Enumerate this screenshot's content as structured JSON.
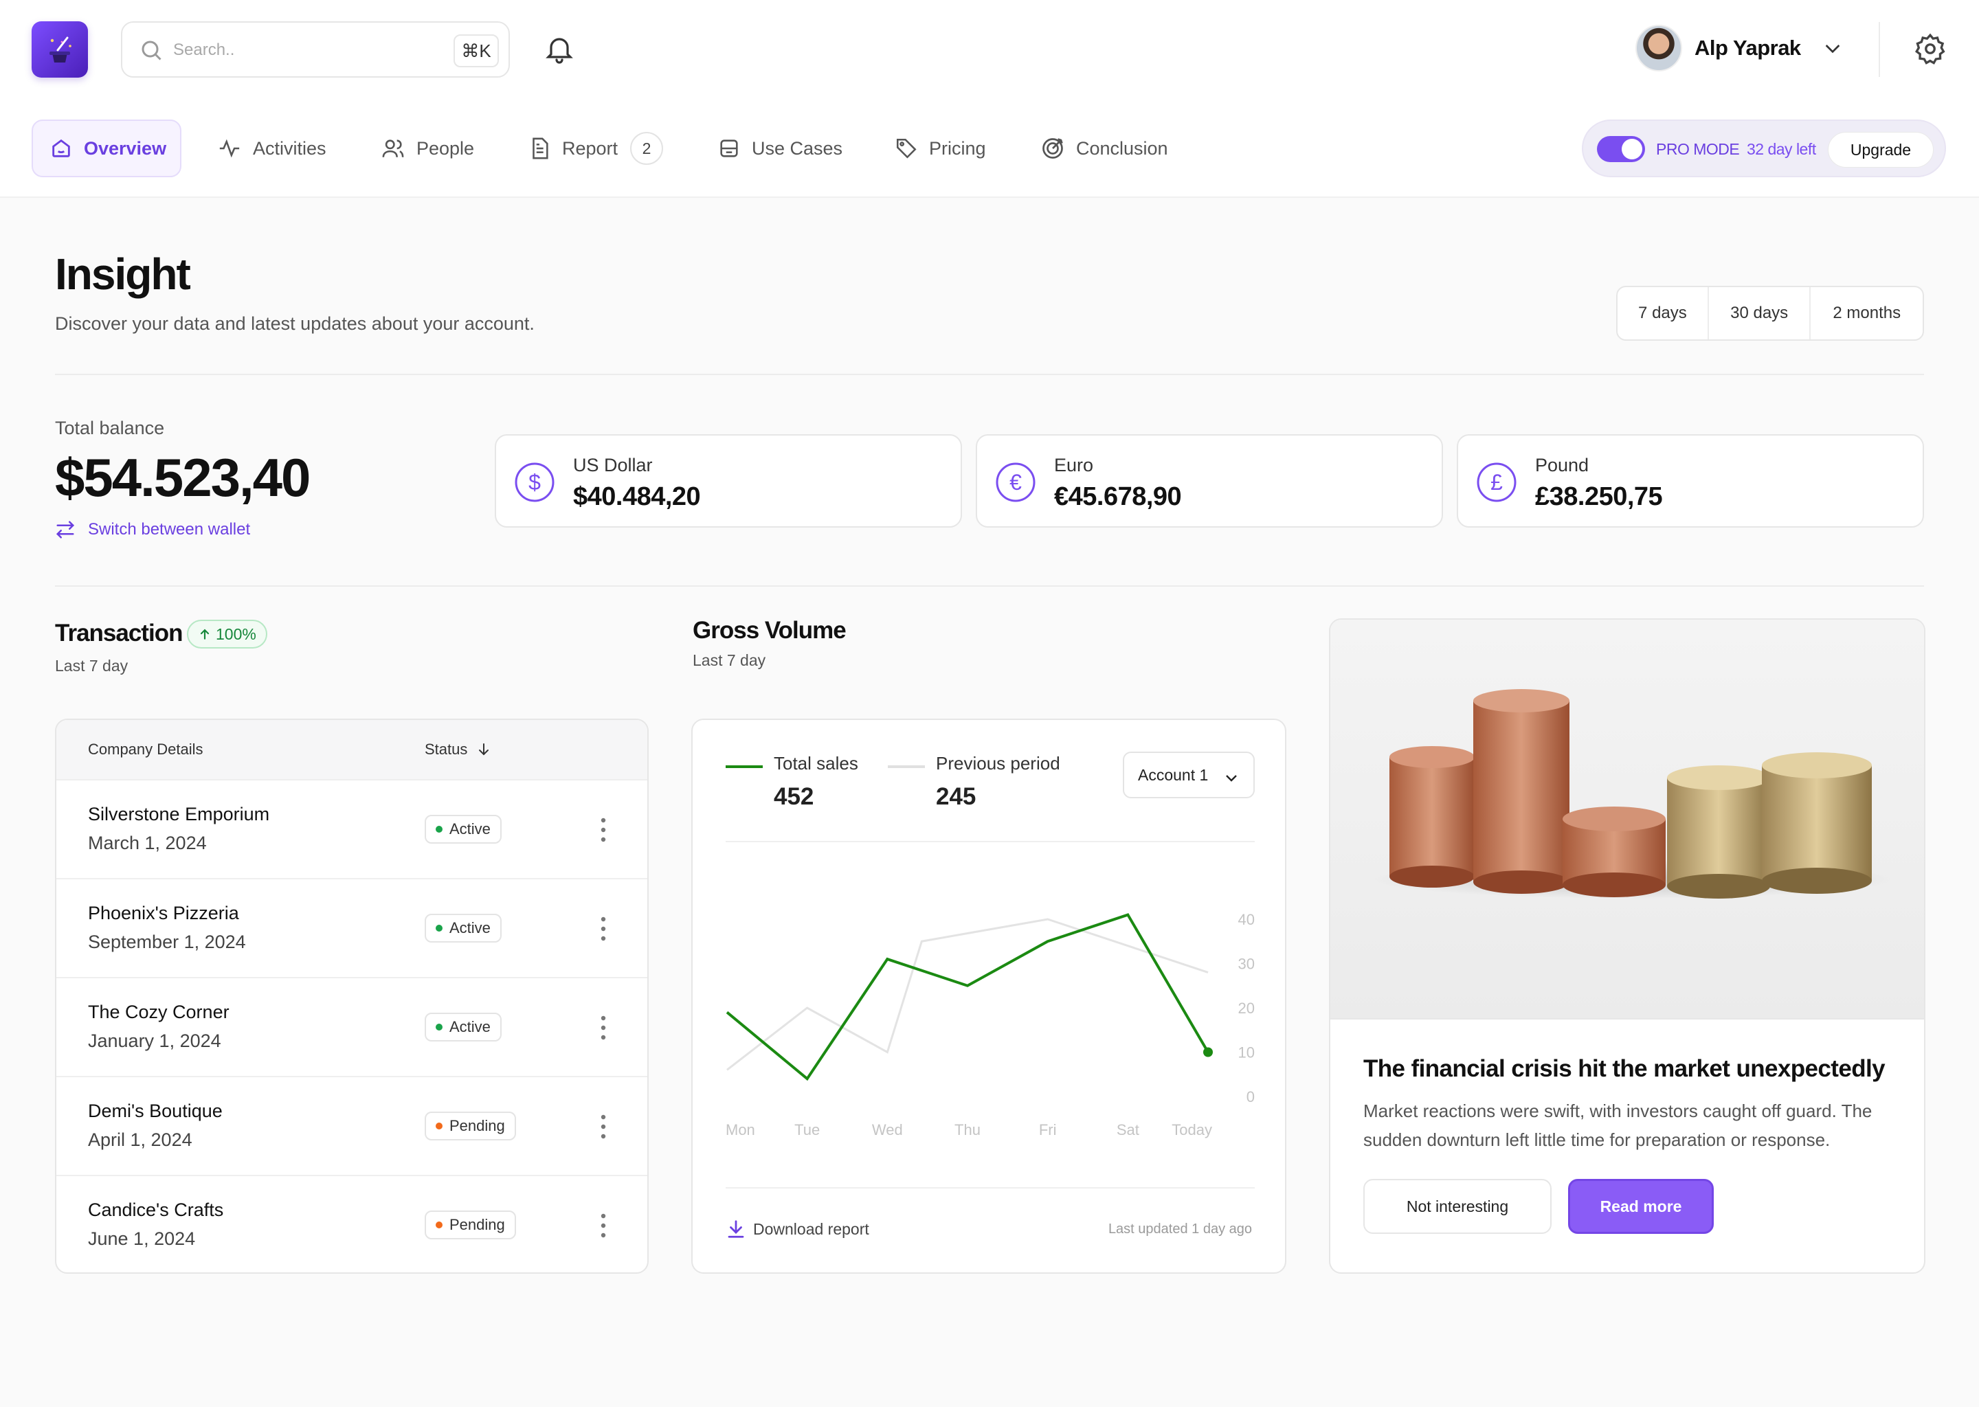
{
  "search": {
    "placeholder": "Search..",
    "shortcut": "⌘K"
  },
  "user": {
    "name": "Alp Yaprak"
  },
  "nav": {
    "items": [
      {
        "label": "Overview",
        "icon": "home-icon",
        "active": true
      },
      {
        "label": "Activities",
        "icon": "activity-icon"
      },
      {
        "label": "People",
        "icon": "people-icon"
      },
      {
        "label": "Report",
        "icon": "document-icon",
        "badge": "2"
      },
      {
        "label": "Use Cases",
        "icon": "database-icon"
      },
      {
        "label": "Pricing",
        "icon": "tag-icon"
      },
      {
        "label": "Conclusion",
        "icon": "target-icon"
      }
    ]
  },
  "promo": {
    "mode": "PRO MODE",
    "days_left": "32 day left",
    "upgrade": "Upgrade",
    "enabled": true
  },
  "page": {
    "title": "Insight",
    "subtitle": "Discover your data and latest updates about your account."
  },
  "range": {
    "options": [
      "7 days",
      "30 days",
      "2 months"
    ]
  },
  "balance": {
    "label": "Total balance",
    "amount": "$54.523,40",
    "switch_label": "Switch between wallet",
    "currencies": [
      {
        "name": "US Dollar",
        "value": "$40.484,20",
        "symbol": "$",
        "icon": "dollar-icon"
      },
      {
        "name": "Euro",
        "value": "€45.678,90",
        "symbol": "€",
        "icon": "euro-icon"
      },
      {
        "name": "Pound",
        "value": "£38.250,75",
        "symbol": "£",
        "icon": "pound-icon"
      }
    ]
  },
  "transaction": {
    "title": "Transaction",
    "change": "100%",
    "subtitle": "Last 7 day",
    "columns": [
      "Company Details",
      "Status"
    ],
    "rows": [
      {
        "name": "Silverstone Emporium",
        "date": "March 1, 2024",
        "status": "Active"
      },
      {
        "name": "Phoenix's Pizzeria",
        "date": "September 1, 2024",
        "status": "Active"
      },
      {
        "name": "The Cozy Corner",
        "date": "January 1, 2024",
        "status": "Active"
      },
      {
        "name": "Demi's Boutique",
        "date": "April 1, 2024",
        "status": "Pending"
      },
      {
        "name": "Candice's Crafts",
        "date": "June 1, 2024",
        "status": "Pending"
      }
    ]
  },
  "gross_volume": {
    "title": "Gross Volume",
    "subtitle": "Last 7 day",
    "account": "Account 1",
    "download": "Download report",
    "updated": "Last updated 1 day ago"
  },
  "chart_data": {
    "type": "line",
    "categories": [
      "Mon",
      "Tue",
      "Wed",
      "Thu",
      "Fri",
      "Sat",
      "Today"
    ],
    "yticks": [
      0,
      10,
      20,
      30,
      40
    ],
    "ylim": [
      0,
      40
    ],
    "series": [
      {
        "name": "Total sales",
        "total": "452",
        "color": "#1b8a12",
        "points": [
          [
            "Mon",
            19
          ],
          [
            "Tue",
            4
          ],
          [
            "Wed",
            31
          ],
          [
            "Thu",
            25
          ],
          [
            "Fri",
            35
          ],
          [
            "Sat",
            41
          ],
          [
            "Today",
            10
          ]
        ]
      },
      {
        "name": "Previous period",
        "total": "245",
        "color": "#e3e3e3",
        "points": [
          [
            "Mon",
            6
          ],
          [
            "Tue",
            20
          ],
          [
            "Wed",
            10
          ],
          [
            "Wed",
            35
          ],
          [
            "Fri",
            40
          ],
          [
            "Sat",
            34
          ],
          [
            "Today",
            28
          ]
        ]
      }
    ]
  },
  "article": {
    "title": "The financial crisis hit the market unexpectedly",
    "body": "Market reactions were swift, with investors caught off guard. The sudden downturn left little time for preparation or response.",
    "dismiss": "Not interesting",
    "cta": "Read more"
  }
}
